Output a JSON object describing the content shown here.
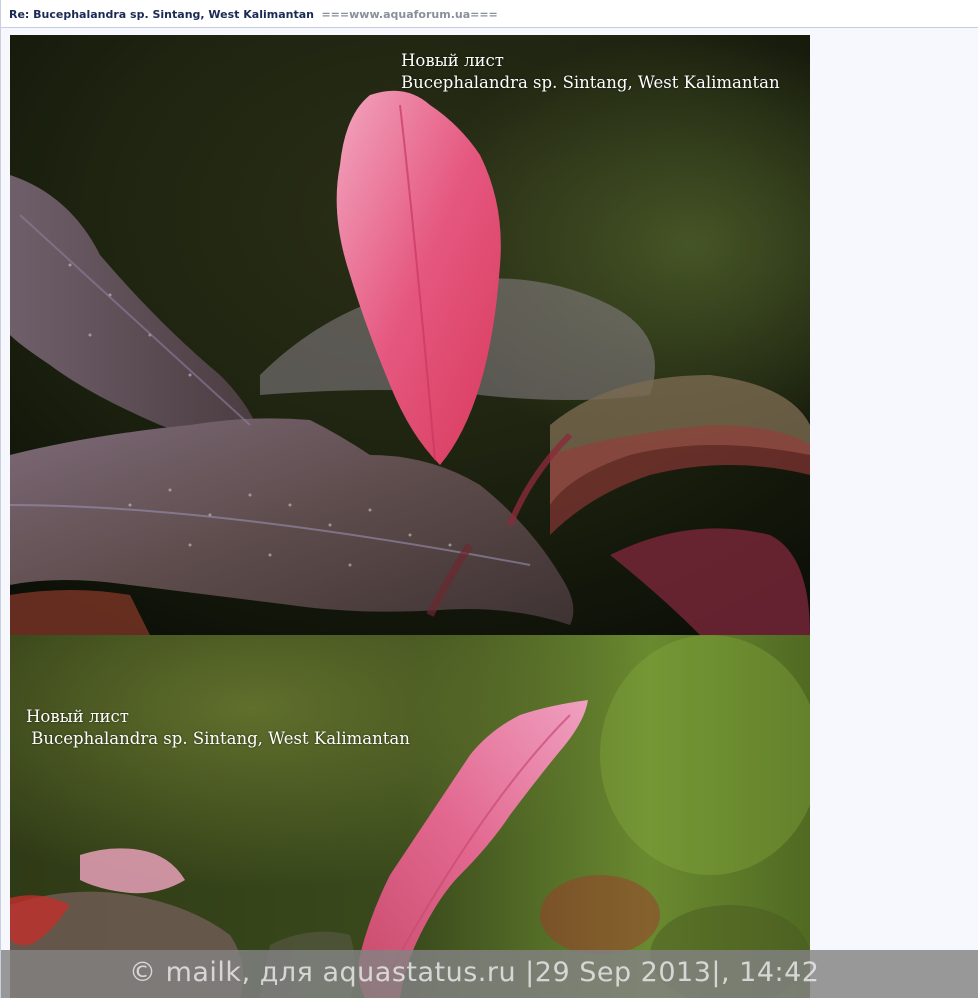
{
  "topic": {
    "subject": "Re: Bucephalandra sp. Sintang, West Kalimantan",
    "forum_suffix": "===www.aquaforum.ua==="
  },
  "photos": [
    {
      "caption_line1": "Новый лист",
      "caption_line2": "Bucephalandra sp. Sintang, West Kalimantan"
    },
    {
      "caption_line1": "Новый лист",
      "caption_line2": " Bucephalandra sp. Sintang, West Kalimantan"
    }
  ],
  "watermark": {
    "text": "© mailk, для aquastatus.ru |29 Sep 2013|, 14:42"
  },
  "colors": {
    "leaf_pink": "#e2547c",
    "leaf_dark": "#5a4a4a",
    "background_green": "#3d4a1e"
  }
}
